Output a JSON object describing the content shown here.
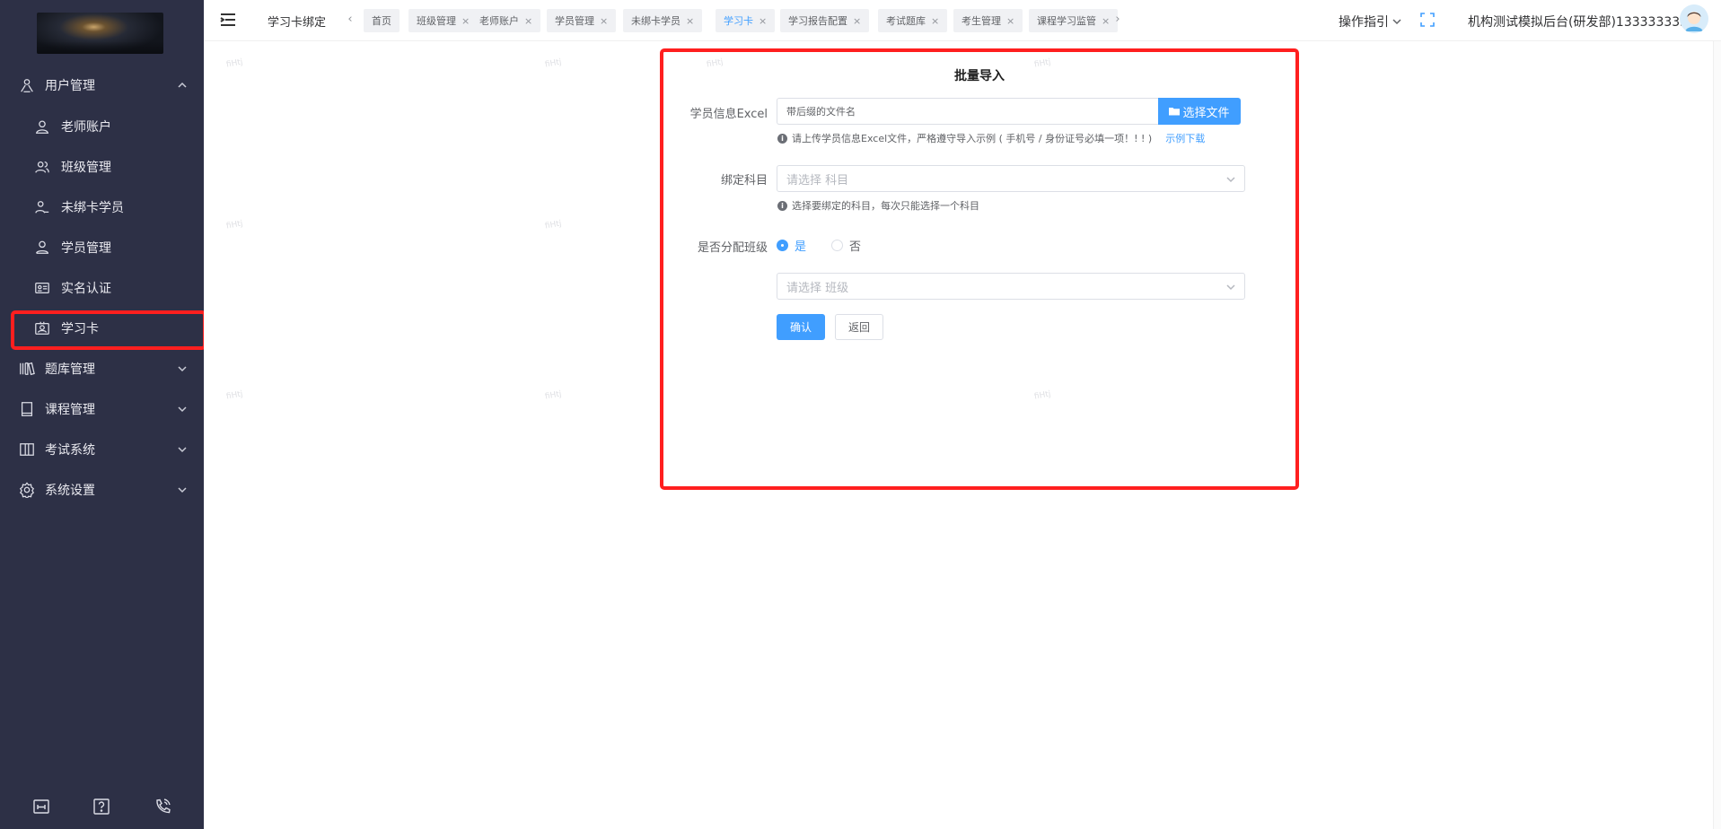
{
  "sidebar": {
    "logo": "logo-image",
    "items": [
      {
        "label": "用户管理",
        "icon": "user-group-icon",
        "expanded": true
      },
      {
        "label": "老师账户",
        "icon": "person-icon"
      },
      {
        "label": "班级管理",
        "icon": "people-icon"
      },
      {
        "label": "未绑卡学员",
        "icon": "person-minus-icon"
      },
      {
        "label": "学员管理",
        "icon": "person-outline-icon"
      },
      {
        "label": "实名认证",
        "icon": "id-card-icon"
      },
      {
        "label": "学习卡",
        "icon": "badge-icon",
        "active": true
      },
      {
        "label": "题库管理",
        "icon": "books-icon"
      },
      {
        "label": "课程管理",
        "icon": "book-icon"
      },
      {
        "label": "考试系统",
        "icon": "exam-icon"
      },
      {
        "label": "系统设置",
        "icon": "gear-icon"
      }
    ],
    "bottom_icons": [
      "screen-icon",
      "help-icon",
      "phone-icon"
    ]
  },
  "header": {
    "page_title": "学习卡绑定",
    "tabs": [
      {
        "label": "首页",
        "closable": false
      },
      {
        "label": "班级管理",
        "closable": true
      },
      {
        "label": "老师账户",
        "closable": true
      },
      {
        "label": "学员管理",
        "closable": true
      },
      {
        "label": "未绑卡学员",
        "closable": true
      },
      {
        "label": "学习卡",
        "closable": true,
        "active": true
      },
      {
        "label": "学习报告配置",
        "closable": true
      },
      {
        "label": "考试题库",
        "closable": true
      },
      {
        "label": "考生管理",
        "closable": true
      },
      {
        "label": "课程学习监管",
        "closable": true
      }
    ],
    "close_glyph": "×",
    "prev_arrow": "‹",
    "next_arrow": "›",
    "guide_label": "操作指引",
    "user_name": "机构测试模拟后台(研发部)1333333333"
  },
  "form": {
    "title": "批量导入",
    "excel_label": "学员信息Excel",
    "file_placeholder": "带后缀的文件名",
    "file_button": "选择文件",
    "excel_hint": "请上传学员信息Excel文件，严格遵守导入示例 ( 手机号 / 身份证号必填一项！! ! )",
    "example_link": "示例下载",
    "subject_label": "绑定科目",
    "subject_placeholder": "请选择 科目",
    "subject_hint": "选择要绑定的科目，每次只能选择一个科目",
    "assign_label": "是否分配班级",
    "radio_yes": "是",
    "radio_no": "否",
    "assign_value": "是",
    "class_placeholder": "请选择 班级",
    "confirm_button": "确认",
    "back_button": "返回"
  },
  "watermark_text": "fiHtj"
}
